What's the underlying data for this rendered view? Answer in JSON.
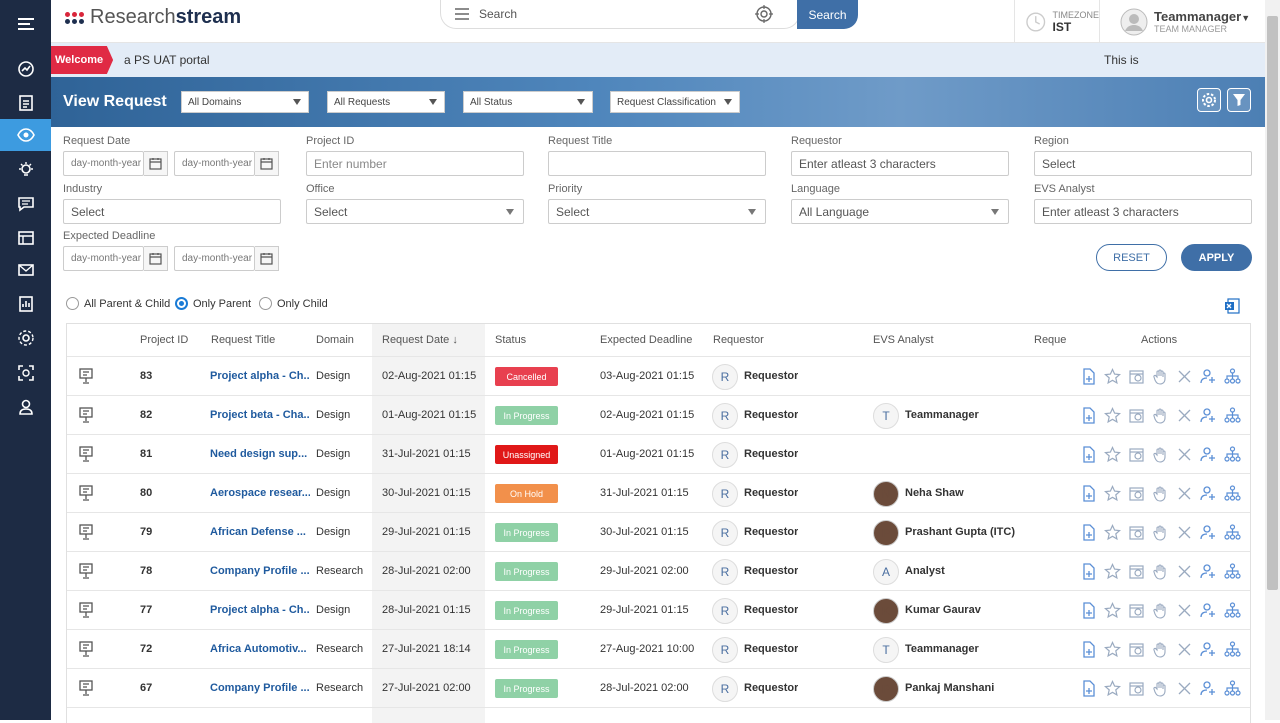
{
  "app": {
    "logo_text_light": "Research",
    "logo_text_bold": "stream",
    "search_placeholder": "Search",
    "search_button": "Search",
    "timezone_label": "TIMEZONE",
    "timezone_value": "IST",
    "user_name": "Teammanager",
    "user_role": "TEAM MANAGER"
  },
  "sidebar": {
    "items": [
      {
        "icon": "menu-icon",
        "active": false
      },
      {
        "icon": "dashboard-icon",
        "active": false
      },
      {
        "icon": "document-icon",
        "active": false
      },
      {
        "icon": "eye-icon",
        "active": true
      },
      {
        "icon": "bulb-icon",
        "active": false
      },
      {
        "icon": "chat-icon",
        "active": false
      },
      {
        "icon": "list-icon",
        "active": false
      },
      {
        "icon": "mail-icon",
        "active": false
      },
      {
        "icon": "report-icon",
        "active": false
      },
      {
        "icon": "settings-icon",
        "active": false
      },
      {
        "icon": "scan-icon",
        "active": false
      },
      {
        "icon": "user-icon",
        "active": false
      }
    ]
  },
  "welcome": {
    "tag": "Welcome",
    "message_left": "a PS UAT portal",
    "message_right": "This is"
  },
  "header": {
    "title": "View Request",
    "domains": "All Domains",
    "requests": "All Requests",
    "status": "All Status",
    "classification": "Request Classification"
  },
  "filters": {
    "request_date_label": "Request Date",
    "date_placeholder": "day-month-year",
    "project_id_label": "Project ID",
    "project_id_placeholder": "Enter number",
    "request_title_label": "Request Title",
    "requestor_label": "Requestor",
    "requestor_placeholder": "Enter atleast 3 characters",
    "region_label": "Region",
    "region_value": "Select",
    "industry_label": "Industry",
    "industry_value": "Select",
    "office_label": "Office",
    "office_value": "Select",
    "priority_label": "Priority",
    "priority_value": "Select",
    "language_label": "Language",
    "language_value": "All Language",
    "evs_label": "EVS Analyst",
    "evs_placeholder": "Enter atleast 3 characters",
    "deadline_label": "Expected Deadline",
    "reset": "RESET",
    "apply": "APPLY"
  },
  "view_mode": {
    "options": [
      "All Parent & Child",
      "Only Parent",
      "Only Child"
    ],
    "selected": "Only Parent"
  },
  "table": {
    "headers": {
      "project_id": "Project ID",
      "request_title": "Request Title",
      "domain": "Domain",
      "request_date": "Request Date ↓",
      "status": "Status",
      "expected_deadline": "Expected Deadline",
      "requestor": "Requestor",
      "evs_analyst": "EVS Analyst",
      "reque": "Reque",
      "actions": "Actions"
    },
    "status_colors": {
      "Cancelled": "#e8404f",
      "In Progress": "#8fd1a6",
      "Unassigned": "#e01818",
      "On Hold": "#f2904b"
    },
    "rows": [
      {
        "id": "83",
        "title": "Project alpha - Ch...",
        "domain": "Design",
        "date": "02-Aug-2021 01:15",
        "status": "Cancelled",
        "deadline": "03-Aug-2021 01:15",
        "req_initial": "R",
        "requestor": "Requestor",
        "analyst_initial": "",
        "analyst": "",
        "photo": false
      },
      {
        "id": "82",
        "title": "Project beta - Cha...",
        "domain": "Design",
        "date": "01-Aug-2021 01:15",
        "status": "In Progress",
        "deadline": "02-Aug-2021 01:15",
        "req_initial": "R",
        "requestor": "Requestor",
        "analyst_initial": "T",
        "analyst": "Teammanager",
        "photo": false
      },
      {
        "id": "81",
        "title": "Need design sup...",
        "domain": "Design",
        "date": "31-Jul-2021 01:15",
        "status": "Unassigned",
        "deadline": "01-Aug-2021 01:15",
        "req_initial": "R",
        "requestor": "Requestor",
        "analyst_initial": "",
        "analyst": "",
        "photo": false
      },
      {
        "id": "80",
        "title": "Aerospace resear...",
        "domain": "Design",
        "date": "30-Jul-2021 01:15",
        "status": "On Hold",
        "deadline": "31-Jul-2021 01:15",
        "req_initial": "R",
        "requestor": "Requestor",
        "analyst_initial": "N",
        "analyst": "Neha Shaw",
        "photo": true
      },
      {
        "id": "79",
        "title": "African Defense ...",
        "domain": "Design",
        "date": "29-Jul-2021 01:15",
        "status": "In Progress",
        "deadline": "30-Jul-2021 01:15",
        "req_initial": "R",
        "requestor": "Requestor",
        "analyst_initial": "P",
        "analyst": "Prashant Gupta (ITC)",
        "photo": true
      },
      {
        "id": "78",
        "title": "Company Profile ...",
        "domain": "Research",
        "date": "28-Jul-2021 02:00",
        "status": "In Progress",
        "deadline": "29-Jul-2021 02:00",
        "req_initial": "R",
        "requestor": "Requestor",
        "analyst_initial": "A",
        "analyst": "Analyst",
        "photo": false
      },
      {
        "id": "77",
        "title": "Project alpha - Ch...",
        "domain": "Design",
        "date": "28-Jul-2021 01:15",
        "status": "In Progress",
        "deadline": "29-Jul-2021 01:15",
        "req_initial": "R",
        "requestor": "Requestor",
        "analyst_initial": "K",
        "analyst": "Kumar Gaurav",
        "photo": true
      },
      {
        "id": "72",
        "title": "Africa Automotiv...",
        "domain": "Research",
        "date": "27-Jul-2021 18:14",
        "status": "In Progress",
        "deadline": "27-Aug-2021 10:00",
        "req_initial": "R",
        "requestor": "Requestor",
        "analyst_initial": "T",
        "analyst": "Teammanager",
        "photo": false
      },
      {
        "id": "67",
        "title": "Company Profile ...",
        "domain": "Research",
        "date": "27-Jul-2021 02:00",
        "status": "In Progress",
        "deadline": "28-Jul-2021 02:00",
        "req_initial": "R",
        "requestor": "Requestor",
        "analyst_initial": "P",
        "analyst": "Pankaj Manshani",
        "photo": true
      }
    ]
  }
}
